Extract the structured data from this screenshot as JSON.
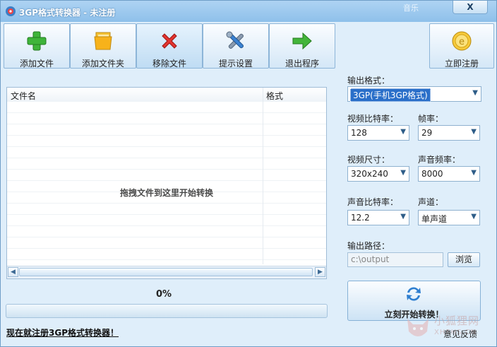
{
  "window": {
    "title": "3GP格式转换器 - 未注册",
    "music_tag": "音乐",
    "close_label": "X"
  },
  "toolbar": {
    "add_file": "添加文件",
    "add_folder": "添加文件夹",
    "remove_file": "移除文件",
    "hint_settings": "提示设置",
    "exit": "退出程序",
    "register": "立即注册"
  },
  "file_list": {
    "col_name": "文件名",
    "col_format": "格式",
    "drop_hint": "拖拽文件到这里开始转换"
  },
  "progress": {
    "percent_label": "0%",
    "value": 0
  },
  "register_link": "现在就注册3GP格式转换器！",
  "settings": {
    "output_format_label": "输出格式：",
    "output_format_value": "3GP(手机3GP格式)",
    "video_bitrate_label": "视频比特率：",
    "video_bitrate_value": "128",
    "framerate_label": "帧率：",
    "framerate_value": "29",
    "video_size_label": "视频尺寸：",
    "video_size_value": "320x240",
    "audio_freq_label": "声音频率：",
    "audio_freq_value": "8000",
    "audio_bitrate_label": "声音比特率：",
    "audio_bitrate_value": "12.2",
    "channel_label": "声道：",
    "channel_value": "单声道",
    "output_path_label": "输出路径：",
    "output_path_value": "c:\\output",
    "browse_label": "浏览"
  },
  "start_button": "立刻开始转换！",
  "feedback": "意见反馈",
  "watermark": {
    "line1": "小狐狸网",
    "line2": "XHEHS.CN"
  },
  "colors": {
    "titlebar": "#8ec0ea",
    "window_bg": "#dfeefa",
    "accent": "#2a6fc9"
  }
}
